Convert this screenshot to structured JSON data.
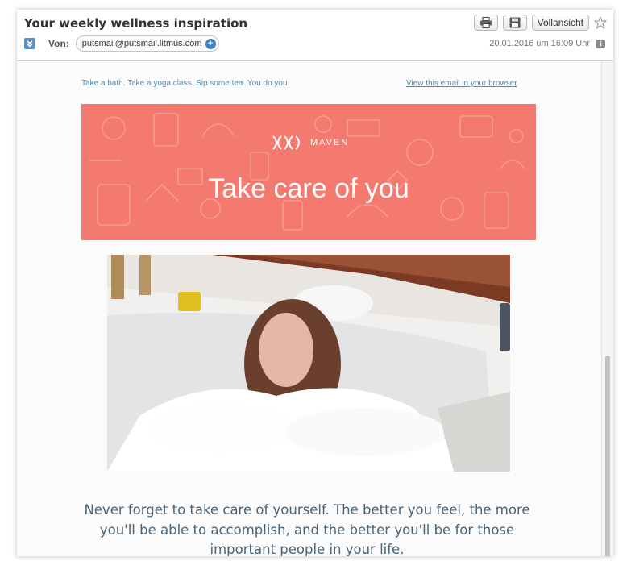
{
  "header": {
    "subject": "Your weekly wellness inspiration",
    "from_label": "Von:",
    "from_address": "putsmail@putsmail.litmus.com",
    "date": "20.01.2016 um 16:09 Uhr",
    "full_view_label": "Vollansicht",
    "icons": [
      "print-icon",
      "save-icon",
      "star-icon",
      "info-icon",
      "collapse-icon",
      "add-contact-icon"
    ]
  },
  "email": {
    "preheader": "Take a bath. Take a yoga class. Sip some tea. You do you.",
    "view_in_browser": "View this email in your browser",
    "banner": {
      "brand": "MAVEN",
      "title": "Take care of you",
      "color": "#f47a6f"
    },
    "body_text": "Never forget to take care of yourself. The better you feel, the more you'll be able to accomplish, and the better you'll be for those important people in your life."
  },
  "colors": {
    "link": "#4a8db8",
    "body_text": "#4a6478",
    "accent": "#5a8fc4"
  }
}
